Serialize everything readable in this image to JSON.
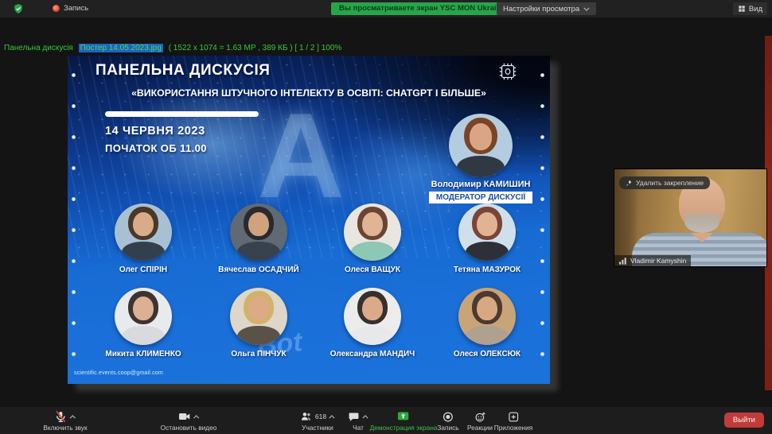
{
  "top_bar": {
    "record_label": "Запись",
    "banner": "Вы просматриваете экран YSC MON Ukraine",
    "settings_label": "Настройки просмотра",
    "view_label": "Вид"
  },
  "viewer": {
    "prefix": "Панельна дискусія",
    "filename": "Постер 14.05.2023.jpg",
    "meta": "( 1522 x 1074 = 1.63 MP , 389 КБ ) [ 1 / 2 ] 100%"
  },
  "poster": {
    "title": "ПАНЕЛЬНА ДИСКУСІЯ",
    "subtitle": "«ВИКОРИСТАННЯ ШТУЧНОГО ІНТЕЛЕКТУ В ОСВІТІ: CHATGPT І БІЛЬШЕ»",
    "date": "14 ЧЕРВНЯ 2023",
    "time": "ПОЧАТОК ОБ 11.00",
    "big_letter": "A",
    "watermark": "Bot",
    "moderator": {
      "name": "Володимир КАМИШИН",
      "role": "МОДЕРАТОР ДИСКУСІЇ"
    },
    "speakers_row1": [
      "Олег СПІРІН",
      "Вячеслав ОСАДЧИЙ",
      "Олеся ВАЩУК",
      "Тетяна МАЗУРОК"
    ],
    "speakers_row2": [
      "Микита КЛИМЕНКО",
      "Ольга ПІНЧУК",
      "Олександра МАНДИЧ",
      "Олеся ОЛЕКСЮК"
    ],
    "email": "scientific.events.coop@gmail.com"
  },
  "video_tile": {
    "pin_label": "Удалить закрепление",
    "participant_name": "Vladimir Kamyshin"
  },
  "toolbar": {
    "unmute_label": "Включить звук",
    "stop_video_label": "Остановить видео",
    "participants_label": "Участники",
    "participants_count": "618",
    "chat_label": "Чат",
    "share_label": "Демонстрация экрана",
    "record_label": "Запись",
    "reactions_label": "Реакции",
    "apps_label": "Приложения",
    "leave_label": "Выйти"
  },
  "colors": {
    "banner_green": "#27a648",
    "share_green": "#36b34a",
    "leave_red": "#c23b3b",
    "record_red": "#e04433",
    "poster_blue": "#1a70d8",
    "titlebar_text_green": "#35c93a",
    "moderator_role_blue": "#1b4fa0"
  }
}
